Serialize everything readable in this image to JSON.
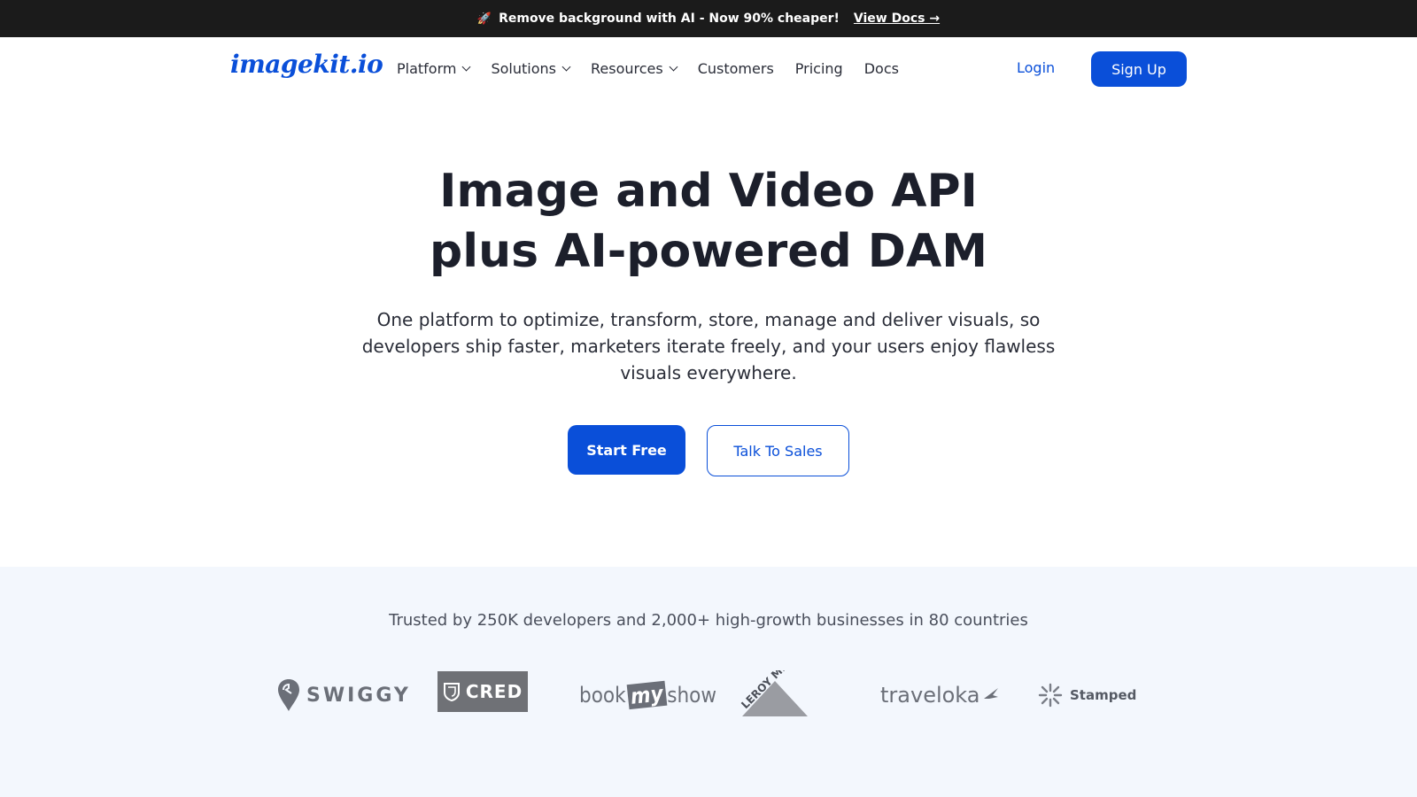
{
  "announcement": {
    "icon": "rocket-icon",
    "rocket_glyph": "🚀",
    "text": "Remove background with AI - Now 90% cheaper!",
    "link_label": "View Docs →"
  },
  "nav": {
    "logo": "imagekit.io",
    "items": [
      {
        "label": "Platform",
        "dropdown": true
      },
      {
        "label": "Solutions",
        "dropdown": true
      },
      {
        "label": "Resources",
        "dropdown": true
      },
      {
        "label": "Customers",
        "dropdown": false
      },
      {
        "label": "Pricing",
        "dropdown": false
      },
      {
        "label": "Docs",
        "dropdown": false
      }
    ],
    "login_label": "Login",
    "signup_label": "Sign Up"
  },
  "hero": {
    "title_line1": "Image and Video API",
    "title_line2": "plus AI-powered DAM",
    "subtitle": "One platform to optimize, transform, store, manage and deliver visuals, so developers ship faster, marketers iterate freely, and your users enjoy flawless visuals everywhere.",
    "primary_cta": "Start Free",
    "secondary_cta": "Talk To Sales"
  },
  "trusted": {
    "text": "Trusted by 250K developers and 2,000+ high-growth businesses in 80 countries",
    "logos": {
      "swiggy": "SWIGGY",
      "cred": "CRED",
      "bms_book": "book",
      "bms_my": "my",
      "bms_show": "show",
      "leroy": "LEROY MERLIN",
      "traveloka": "traveloka",
      "stamped": "Stamped"
    }
  },
  "colors": {
    "brand_blue": "#0a4fd9",
    "announcement_bg": "#1b1b1b",
    "trusted_bg": "#f3f7fd"
  }
}
